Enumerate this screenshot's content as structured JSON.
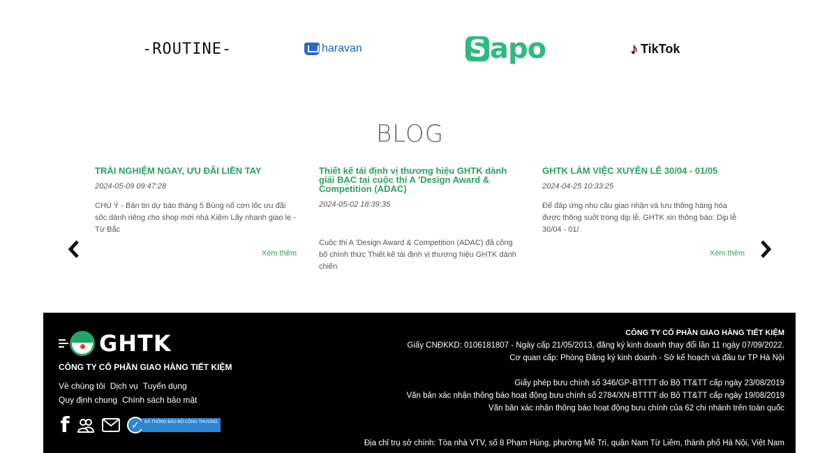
{
  "partners": {
    "routine": "-ROUTINE-",
    "haravan": "haravan",
    "sapo": "apo",
    "sapo_s": "S",
    "tiktok": "TikTok"
  },
  "blog": {
    "title": "BLOG",
    "posts": [
      {
        "title": "TRẢI NGHIỆM NGAY, ƯU ĐÃI LIỀN TAY",
        "date": "2024-05-09 09:47:28",
        "excerpt": "CHÚ Ý - Bản tin dự báo tháng 5 Bùng nổ cơn lốc ưu đãi sốc dành riêng cho shop mới nhà Kiệm Lấy nhanh giao lẹ - Từ Bắc",
        "more": "Xem thêm"
      },
      {
        "title": "Thiết kế tái định vị thương hiệu GHTK dành giải BẠC tại cuộc thi A 'Design Award & Competition (ADAC)",
        "date": "2024-05-02 18:39:35",
        "excerpt": "Cuộc thi A 'Design Award & Competition (ADAC) đã công bố chính thức Thiết kế tái định vị thương hiệu GHTK dành chiến"
      },
      {
        "title": "GHTK LÀM VIỆC XUYÊN LỄ 30/04 - 01/05",
        "date": "2024-04-25 10:33:25",
        "excerpt": "Để đáp ứng nhu cầu giao nhận và lưu thông hàng hóa được thông suốt trong dịp lễ, GHTK xin thông báo: Dịp lễ 30/04 - 01/",
        "more": "Xem thêm"
      }
    ]
  },
  "footer": {
    "brand": "GHTK",
    "company": "CÔNG TY CỔ PHẦN GIAO HÀNG TIẾT KIỆM",
    "links": [
      "Về chúng tôi",
      "Dịch vụ",
      "Tuyển dụng",
      "Quy định chung",
      "Chính sách bảo mật"
    ],
    "badge_text": "ĐÃ THÔNG BÁO BỘ CÔNG THƯƠNG",
    "right": {
      "header": "CÔNG TY CỔ PHẦN GIAO HÀNG TIẾT KIỆM",
      "license": "Giấy CNĐKKD: 0106181807 - Ngày cấp 21/05/2013, đăng ký kinh doanh thay đổi lần 11 ngày 07/09/2022.",
      "issuer": "Cơ quan cấp: Phòng Đăng ký kinh doanh - Sở kế hoạch và đầu tư TP Hà Nội",
      "postal_license": "Giấy phép bưu chính số 346/GP-BTTTT do Bộ TT&TT cấp ngày 23/08/2019",
      "postal_confirm": "Văn bản xác nhận thông báo hoạt động bưu chính số 2784/XN-BTTTT do Bộ TT&TT cấp ngày 19/08/2019",
      "branches": "Văn bản xác nhận thông báo hoạt động bưu chính của 62 chi nhánh trên toàn quốc",
      "address": "Địa chỉ trụ sở chính: Tòa nhà VTV, số 8 Phạm Hùng, phường Mễ Trì, quận Nam Từ Liêm, thành phố Hà Nội, Việt Nam"
    }
  },
  "colors": {
    "accent": "#2aa35a",
    "footer_bg": "#000000"
  },
  "icons": [
    "chevron-left-icon",
    "chevron-right-icon",
    "facebook-icon",
    "group-icon",
    "mail-icon",
    "verified-badge-icon"
  ]
}
